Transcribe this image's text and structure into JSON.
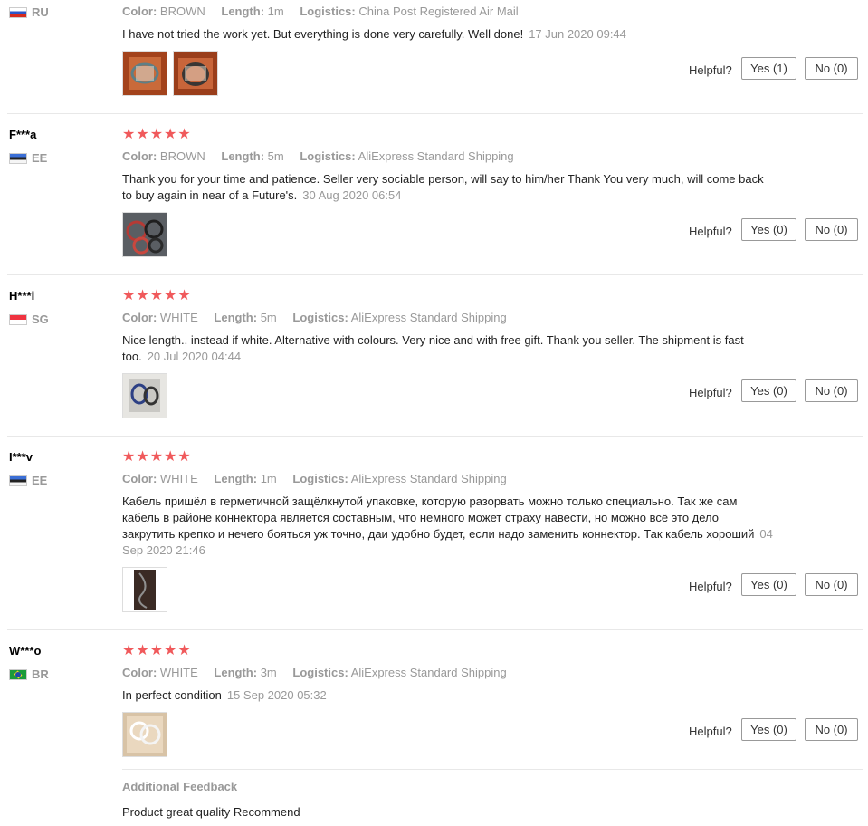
{
  "labels": {
    "color": "Color:",
    "length": "Length:",
    "logistics": "Logistics:",
    "helpful": "Helpful?"
  },
  "star_color": "#f0595b",
  "reviews": [
    {
      "user": "",
      "country": "RU",
      "flag": "ru-flag-icon",
      "rating": null,
      "color": "BROWN",
      "length": "1m",
      "logistics": "China Post Registered Air Mail",
      "text": "I have not tried the work yet. But everything is done very carefully. Well done!",
      "date": "17 Jun 2020 09:44",
      "yes": "Yes (1)",
      "no": "No (0)",
      "images": 2
    },
    {
      "user": "F***a",
      "country": "EE",
      "flag": "ee-flag-icon",
      "rating": 5,
      "color": "BROWN",
      "length": "5m",
      "logistics": "AliExpress Standard Shipping",
      "text": "Thank you for your time and patience. Seller very sociable person, will say to him/her Thank You very much, will come back to buy again in near of a Future's.",
      "date": "30 Aug 2020 06:54",
      "yes": "Yes (0)",
      "no": "No (0)",
      "images": 1
    },
    {
      "user": "H***i",
      "country": "SG",
      "flag": "sg-flag-icon",
      "rating": 5,
      "color": "WHITE",
      "length": "5m",
      "logistics": "AliExpress Standard Shipping",
      "text": "Nice length.. instead if white. Alternative with colours. Very nice and with free gift. Thank you seller. The shipment is fast too.",
      "date": "20 Jul 2020 04:44",
      "yes": "Yes (0)",
      "no": "No (0)",
      "images": 1
    },
    {
      "user": "I***v",
      "country": "EE",
      "flag": "ee-flag-icon",
      "rating": 5,
      "color": "WHITE",
      "length": "1m",
      "logistics": "AliExpress Standard Shipping",
      "text": "Кабель пришёл в герметичной защёлкнутой упаковке, которую разорвать можно только специально. Так же сам кабель в районе коннектора является составным, что немного может страху навести, но можно всё это дело закрутить крепко и нечего бояться уж точно, даи удобно будет, если надо заменить коннектор. Так кабель хороший",
      "date": "04 Sep 2020 21:46",
      "yes": "Yes (0)",
      "no": "No (0)",
      "images": 1
    },
    {
      "user": "W***o",
      "country": "BR",
      "flag": "br-flag-icon",
      "rating": 5,
      "color": "WHITE",
      "length": "3m",
      "logistics": "AliExpress Standard Shipping",
      "text": "In perfect condition",
      "date": "15 Sep 2020 05:32",
      "yes": "Yes (0)",
      "no": "No (0)",
      "images": 1
    }
  ],
  "additional_feedback": {
    "label": "Additional Feedback",
    "text": "Product great quality Recommend"
  }
}
